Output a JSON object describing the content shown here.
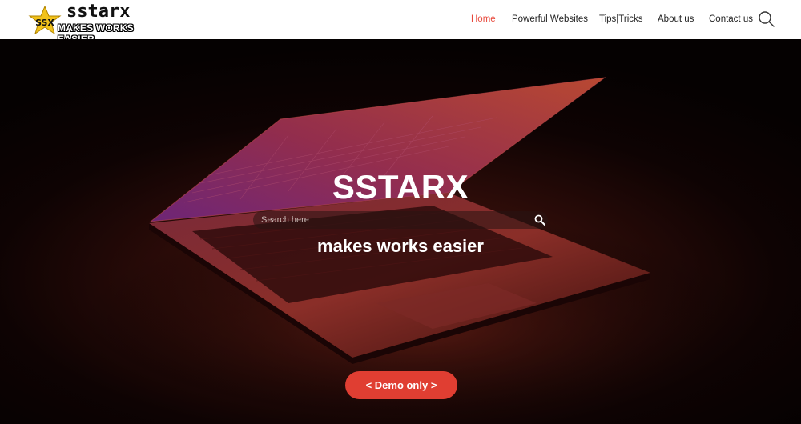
{
  "brand": {
    "name": "sstarx",
    "tagline": "MAKES WORKS EASIER",
    "star_text": "SSX"
  },
  "nav": {
    "items": [
      {
        "label": "Home",
        "active": true
      },
      {
        "label": "Powerful Websites",
        "active": false
      },
      {
        "label": "Tips|Tricks",
        "active": false
      },
      {
        "label": "About us",
        "active": false
      },
      {
        "label": "Contact us",
        "active": false
      }
    ],
    "search_icon": "search-icon"
  },
  "hero": {
    "title": "SSTARX",
    "search_placeholder": "Search here",
    "subtitle": "makes works easier",
    "cta_label": "< Demo only >"
  },
  "colors": {
    "accent": "#e8483b",
    "cta": "#e03e32",
    "logo_star": "#f2c21b"
  }
}
